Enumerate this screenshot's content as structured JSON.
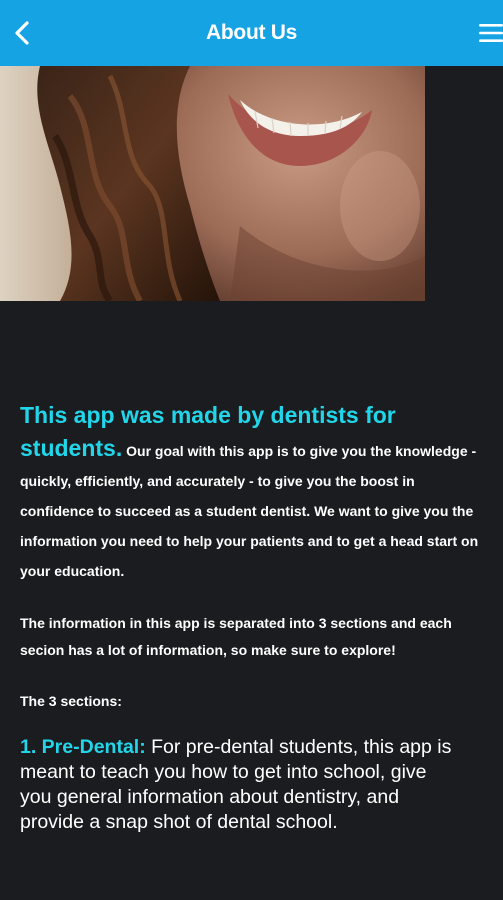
{
  "header": {
    "title": "About Us",
    "back_icon": "chevron-left-icon",
    "menu_icon": "hamburger-menu-icon"
  },
  "colors": {
    "accent": "#16a3e4",
    "highlight": "#22d6ea",
    "background": "#1b1c1f"
  },
  "hero": {
    "image": "smiling-woman-photo"
  },
  "intro": {
    "headline": "This app was made by dentists for students.",
    "body": "Our goal with this app is to give you the knowledge - quickly, efficiently, and accurately - to give you the boost in confidence to succeed as a student dentist. We want to give you the information you need to help your patients and to get a head start on your education."
  },
  "info_paragraph": "The information in this app is separated into 3 sections and each secion has a lot of information, so make sure to explore!",
  "sections_label": "The 3 sections:",
  "sections": [
    {
      "title": "1. Pre-Dental:",
      "body": "For pre-dental students, this app is meant to teach you how to get into school, give you general information about dentistry, and provide a snap shot of dental school."
    }
  ]
}
